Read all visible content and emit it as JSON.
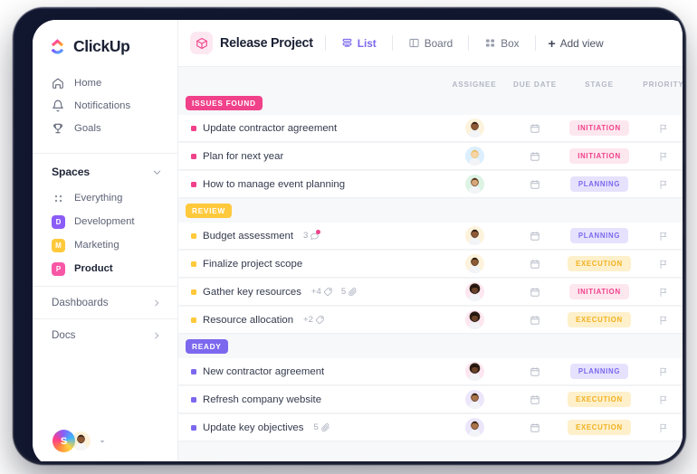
{
  "brand": {
    "name": "ClickUp",
    "logo_icon": "clickup-logo-icon"
  },
  "sidebar": {
    "nav": [
      {
        "label": "Home",
        "icon": "home-icon"
      },
      {
        "label": "Notifications",
        "icon": "bell-icon"
      },
      {
        "label": "Goals",
        "icon": "trophy-icon"
      }
    ],
    "spaces_section": {
      "title": "Spaces",
      "collapse_icon": "chevron-down-icon"
    },
    "spaces": [
      {
        "label": "Everything",
        "type": "dots",
        "icon": "grid-dots-icon",
        "initial": "",
        "color": "#868d9e",
        "active": false
      },
      {
        "label": "Development",
        "type": "square",
        "initial": "D",
        "color": "#8b5cf6",
        "active": false
      },
      {
        "label": "Marketing",
        "type": "square",
        "initial": "M",
        "color": "#ffc93c",
        "active": false
      },
      {
        "label": "Product",
        "type": "square",
        "initial": "P",
        "color": "#f857a6",
        "active": true
      }
    ],
    "bottom_nav": [
      {
        "label": "Dashboards",
        "icon": "chevron-right-icon"
      },
      {
        "label": "Docs",
        "icon": "chevron-right-icon"
      }
    ],
    "footer": {
      "workspace_initial": "S",
      "user_avatar": "user-avatar",
      "caret_icon": "caret-down-icon"
    }
  },
  "header": {
    "project_icon": "box-icon",
    "project_title": "Release Project",
    "views": [
      {
        "label": "List",
        "icon": "list-icon",
        "active": true
      },
      {
        "label": "Board",
        "icon": "board-icon",
        "active": false
      },
      {
        "label": "Box",
        "icon": "box-grid-icon",
        "active": false
      }
    ],
    "add_view": {
      "label": "Add view",
      "icon": "plus-icon"
    }
  },
  "table": {
    "columns": [
      "ASSIGNEE",
      "DUE DATE",
      "STAGE",
      "PRIORITY"
    ]
  },
  "stage_colors": {
    "INITIATION": {
      "bg": "#fde7ef",
      "fg": "#f0418a"
    },
    "PLANNING": {
      "bg": "#e6e2fd",
      "fg": "#7b68ee"
    },
    "EXECUTION": {
      "bg": "#fdf0cb",
      "fg": "#f2b01e"
    }
  },
  "groups": [
    {
      "name": "ISSUES FOUND",
      "badge_color": "#f0418a",
      "bullet_color": "#f0418a",
      "rows": [
        {
          "task": "Update contractor agreement",
          "stage": "INITIATION",
          "avatar": "avatar-1",
          "due_icon": "calendar-icon",
          "priority_icon": "flag-icon",
          "meta": []
        },
        {
          "task": "Plan for next year",
          "stage": "INITIATION",
          "avatar": "avatar-2",
          "due_icon": "calendar-icon",
          "priority_icon": "flag-icon",
          "meta": []
        },
        {
          "task": "How to manage event planning",
          "stage": "PLANNING",
          "avatar": "avatar-3",
          "due_icon": "calendar-icon",
          "priority_icon": "flag-icon",
          "meta": []
        }
      ]
    },
    {
      "name": "REVIEW",
      "badge_color": "#ffc93c",
      "bullet_color": "#ffc93c",
      "rows": [
        {
          "task": "Budget assessment",
          "stage": "PLANNING",
          "avatar": "avatar-4",
          "due_icon": "calendar-icon",
          "priority_icon": "flag-icon",
          "meta": [
            {
              "count": "3",
              "icon": "comment-icon",
              "dot": true
            }
          ]
        },
        {
          "task": "Finalize project scope",
          "stage": "EXECUTION",
          "avatar": "avatar-4",
          "due_icon": "calendar-icon",
          "priority_icon": "flag-icon",
          "meta": []
        },
        {
          "task": "Gather key resources",
          "stage": "INITIATION",
          "avatar": "avatar-5",
          "due_icon": "calendar-icon",
          "priority_icon": "flag-icon",
          "meta": [
            {
              "count": "+4",
              "icon": "tag-icon",
              "dot": false
            },
            {
              "count": "5",
              "icon": "paperclip-icon",
              "dot": false
            }
          ]
        },
        {
          "task": "Resource allocation",
          "stage": "EXECUTION",
          "avatar": "avatar-5",
          "due_icon": "calendar-icon",
          "priority_icon": "flag-icon",
          "meta": [
            {
              "count": "+2",
              "icon": "tag-icon",
              "dot": false
            }
          ]
        }
      ]
    },
    {
      "name": "READY",
      "badge_color": "#7b68ee",
      "bullet_color": "#7b68ee",
      "rows": [
        {
          "task": "New contractor agreement",
          "stage": "PLANNING",
          "avatar": "avatar-5",
          "due_icon": "calendar-icon",
          "priority_icon": "flag-icon",
          "meta": []
        },
        {
          "task": "Refresh company website",
          "stage": "EXECUTION",
          "avatar": "avatar-6",
          "due_icon": "calendar-icon",
          "priority_icon": "flag-icon",
          "meta": []
        },
        {
          "task": "Update key objectives",
          "stage": "EXECUTION",
          "avatar": "avatar-6",
          "due_icon": "calendar-icon",
          "priority_icon": "flag-icon",
          "meta": [
            {
              "count": "5",
              "icon": "paperclip-icon",
              "dot": false
            }
          ]
        }
      ]
    }
  ]
}
